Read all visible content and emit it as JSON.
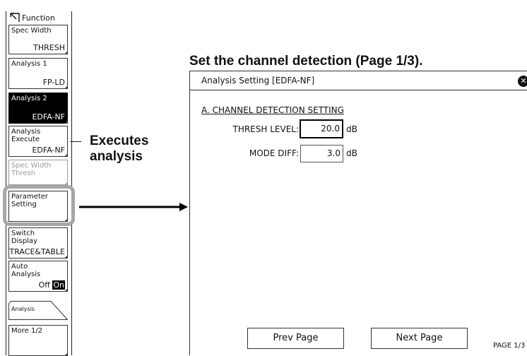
{
  "softkeys": {
    "function_title": "Function",
    "spec_width": {
      "label": "Spec Width",
      "value": "THRESH"
    },
    "analysis1": {
      "label": "Analysis 1",
      "value": "FP-LD"
    },
    "analysis2": {
      "label": "Analysis 2",
      "value": "EDFA-NF"
    },
    "analysis_execute": {
      "label_line1": "Analysis",
      "label_line2": "Execute",
      "value": "EDFA-NF"
    },
    "spec_width_thresh": {
      "label_line1": "Spec Width",
      "label_line2": "Thresh"
    },
    "parameter_setting": {
      "label_line1": "Parameter",
      "label_line2": "Setting"
    },
    "switch_display": {
      "label_line1": "Switch",
      "label_line2": "Display",
      "value": "TRACE&TABLE"
    },
    "auto_analysis": {
      "label_line1": "Auto",
      "label_line2": "Analysis",
      "off": "Off",
      "on": "On"
    },
    "analysis_tab": "Analysis",
    "more": "More 1/2"
  },
  "callouts": {
    "executes_line1": "Executes",
    "executes_line2": "analysis",
    "heading": "Set the channel detection (Page 1/3)."
  },
  "dialog": {
    "title": "Analysis Setting [EDFA-NF]",
    "section_title": "A. CHANNEL DETECTION SETTING",
    "thresh_level": {
      "label": "THRESH LEVEL:",
      "value": "20.0",
      "unit": "dB"
    },
    "mode_diff": {
      "label": "MODE DIFF:",
      "value": "3.0",
      "unit": "dB"
    },
    "prev_page": "Prev Page",
    "next_page": "Next Page",
    "page_indicator": "PAGE 1/3"
  },
  "colors": {
    "highlight_frame": "#a7a7a7",
    "selected_key": "#000000",
    "disabled_text": "#9a9a9a"
  }
}
